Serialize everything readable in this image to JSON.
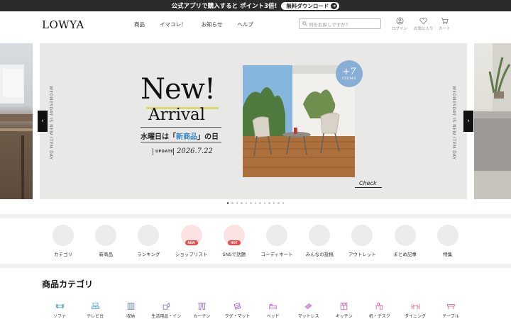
{
  "promo": {
    "text_prefix": "公式アプリで購入すると",
    "text_emph": "ポイント3倍!",
    "button": "無料ダウンロード"
  },
  "header": {
    "logo": "LOWYA",
    "nav": [
      "商品",
      "イマコレ！",
      "お知らせ",
      "ヘルプ"
    ],
    "search_placeholder": "何をお探しですか？",
    "icons": [
      {
        "name": "login-icon",
        "label": "ログイン"
      },
      {
        "name": "favorite-icon",
        "label": "お気に入り"
      },
      {
        "name": "cart-icon",
        "label": "カート"
      }
    ]
  },
  "hero": {
    "side_text": "WEDNESDAY IS NEW ITEM DAY",
    "headline_1": "New!",
    "headline_2": "Arrival",
    "sub_pre": "水曜日は「",
    "sub_hl": "新商品",
    "sub_post": "」の日",
    "update_label": "UPDATE",
    "date": "2026.7.22",
    "badge_count": "+7",
    "badge_label": "ITEMS",
    "check": "Check",
    "slides_total": 13,
    "active_slide": 1
  },
  "shortcuts": [
    {
      "label": "カテゴリ",
      "tag": ""
    },
    {
      "label": "新商品",
      "tag": ""
    },
    {
      "label": "ランキング",
      "tag": ""
    },
    {
      "label": "ショップリスト",
      "tag": "NEW"
    },
    {
      "label": "SNSで話題",
      "tag": "HOT"
    },
    {
      "label": "コーディネート",
      "tag": ""
    },
    {
      "label": "みんなの投稿",
      "tag": ""
    },
    {
      "label": "アウトレット",
      "tag": ""
    },
    {
      "label": "まとめ記事",
      "tag": ""
    },
    {
      "label": "特集",
      "tag": ""
    }
  ],
  "category_section": {
    "title": "商品カテゴリ",
    "items": [
      {
        "label": "ソファ",
        "icon": "sofa-icon",
        "color": "#5aa7d8"
      },
      {
        "label": "テレビ台",
        "icon": "tv-stand-icon",
        "color": "#5aa7d8"
      },
      {
        "label": "収納",
        "icon": "storage-icon",
        "color": "#6f7fd0"
      },
      {
        "label": "生活用品・イン",
        "icon": "goods-icon",
        "color": "#8a7ad0"
      },
      {
        "label": "カーテン",
        "icon": "curtain-icon",
        "color": "#9a6fd0"
      },
      {
        "label": "ラグ・マット",
        "icon": "rug-icon",
        "color": "#a36fd0"
      },
      {
        "label": "ベッド",
        "icon": "bed-icon",
        "color": "#b06fd0"
      },
      {
        "label": "マットレス",
        "icon": "mattress-icon",
        "color": "#c06fc8"
      },
      {
        "label": "キッチン",
        "icon": "kitchen-icon",
        "color": "#d06fb8"
      },
      {
        "label": "机・デスク",
        "icon": "desk-icon",
        "color": "#d86fa8"
      },
      {
        "label": "ダイニング",
        "icon": "dining-icon",
        "color": "#de6f9a"
      },
      {
        "label": "テーブル",
        "icon": "table-icon",
        "color": "#e06f8c"
      }
    ]
  }
}
